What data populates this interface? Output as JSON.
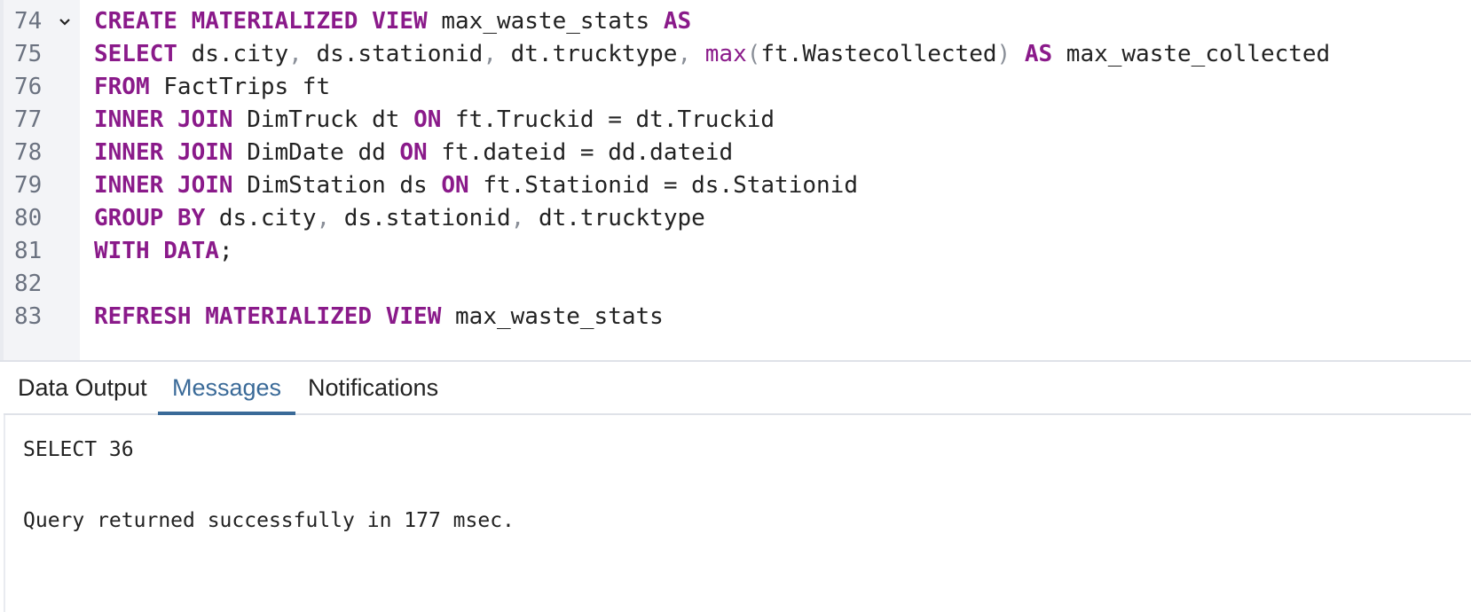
{
  "editor": {
    "lines": [
      {
        "num": "74",
        "fold": true,
        "tokens": [
          {
            "t": "CREATE",
            "c": "kw"
          },
          {
            "t": " "
          },
          {
            "t": "MATERIALIZED",
            "c": "kw"
          },
          {
            "t": " "
          },
          {
            "t": "VIEW",
            "c": "kw"
          },
          {
            "t": " max_waste_stats "
          },
          {
            "t": "AS",
            "c": "kw"
          }
        ]
      },
      {
        "num": "75",
        "fold": false,
        "tokens": [
          {
            "t": "SELECT",
            "c": "kw"
          },
          {
            "t": " ds.city"
          },
          {
            "t": ",",
            "c": "pn"
          },
          {
            "t": " ds.stationid"
          },
          {
            "t": ",",
            "c": "pn"
          },
          {
            "t": " dt.trucktype"
          },
          {
            "t": ",",
            "c": "pn"
          },
          {
            "t": " "
          },
          {
            "t": "max",
            "c": "fn"
          },
          {
            "t": "(",
            "c": "pn"
          },
          {
            "t": "ft.Wastecollected"
          },
          {
            "t": ")",
            "c": "pn"
          },
          {
            "t": " "
          },
          {
            "t": "AS",
            "c": "kw"
          },
          {
            "t": " max_waste_collected"
          }
        ]
      },
      {
        "num": "76",
        "fold": false,
        "tokens": [
          {
            "t": "FROM",
            "c": "kw"
          },
          {
            "t": " FactTrips ft"
          }
        ]
      },
      {
        "num": "77",
        "fold": false,
        "tokens": [
          {
            "t": "INNER",
            "c": "kw"
          },
          {
            "t": " "
          },
          {
            "t": "JOIN",
            "c": "kw"
          },
          {
            "t": " DimTruck dt "
          },
          {
            "t": "ON",
            "c": "kw"
          },
          {
            "t": " ft.Truckid = dt.Truckid"
          }
        ]
      },
      {
        "num": "78",
        "fold": false,
        "tokens": [
          {
            "t": "INNER",
            "c": "kw"
          },
          {
            "t": " "
          },
          {
            "t": "JOIN",
            "c": "kw"
          },
          {
            "t": " DimDate dd "
          },
          {
            "t": "ON",
            "c": "kw"
          },
          {
            "t": " ft.dateid = dd.dateid"
          }
        ]
      },
      {
        "num": "79",
        "fold": false,
        "tokens": [
          {
            "t": "INNER",
            "c": "kw"
          },
          {
            "t": " "
          },
          {
            "t": "JOIN",
            "c": "kw"
          },
          {
            "t": " DimStation ds "
          },
          {
            "t": "ON",
            "c": "kw"
          },
          {
            "t": " ft.Stationid = ds.Stationid"
          }
        ]
      },
      {
        "num": "80",
        "fold": false,
        "tokens": [
          {
            "t": "GROUP",
            "c": "kw"
          },
          {
            "t": " "
          },
          {
            "t": "BY",
            "c": "kw"
          },
          {
            "t": " ds.city"
          },
          {
            "t": ",",
            "c": "pn"
          },
          {
            "t": " ds.stationid"
          },
          {
            "t": ",",
            "c": "pn"
          },
          {
            "t": " dt.trucktype"
          }
        ]
      },
      {
        "num": "81",
        "fold": false,
        "tokens": [
          {
            "t": "WITH",
            "c": "kw"
          },
          {
            "t": " "
          },
          {
            "t": "DATA",
            "c": "kw"
          },
          {
            "t": ";"
          }
        ]
      },
      {
        "num": "82",
        "fold": false,
        "tokens": []
      },
      {
        "num": "83",
        "fold": false,
        "tokens": [
          {
            "t": "REFRESH",
            "c": "kw"
          },
          {
            "t": " "
          },
          {
            "t": "MATERIALIZED",
            "c": "kw"
          },
          {
            "t": " "
          },
          {
            "t": "VIEW",
            "c": "kw"
          },
          {
            "t": " max_waste_stats"
          }
        ]
      }
    ]
  },
  "tabs": {
    "data_output": "Data Output",
    "messages": "Messages",
    "notifications": "Notifications",
    "active": "messages"
  },
  "output": {
    "line1": "SELECT 36",
    "line2": "Query returned successfully in 177 msec."
  },
  "colors": {
    "keyword": "#8a1a8a",
    "active_tab": "#3a6a98",
    "gutter_bg": "#f3f4f7"
  }
}
